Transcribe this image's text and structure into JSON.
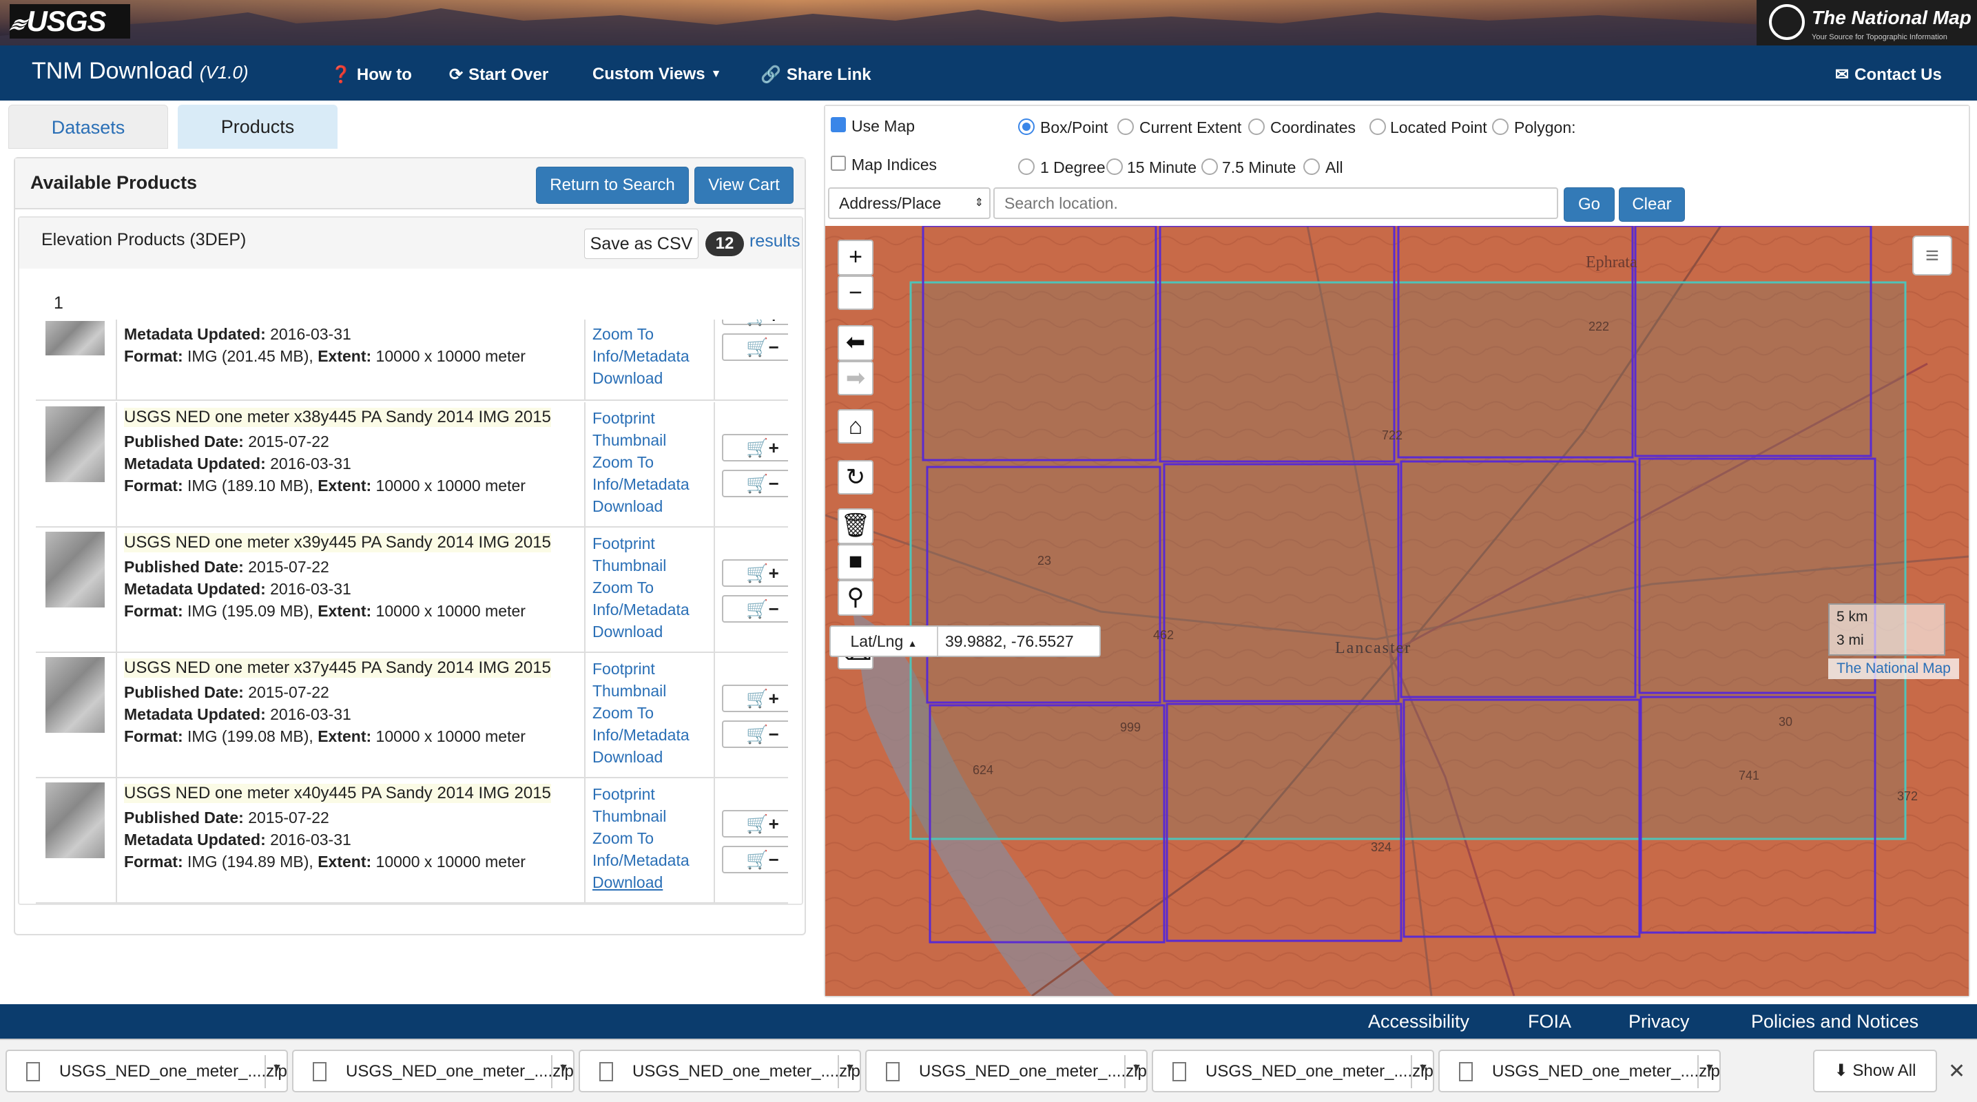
{
  "banner": {
    "usgs_logo": "USGS",
    "tnm_title": "The National Map",
    "tnm_subtitle": "Your Source for Topographic Information"
  },
  "navbar": {
    "brand": "TNM Download",
    "version": "(V1.0)",
    "how_to": "How to",
    "start_over": "Start Over",
    "custom_views": "Custom Views",
    "share_link": "Share Link",
    "contact_us": "Contact Us"
  },
  "tabs": {
    "datasets": "Datasets",
    "products": "Products"
  },
  "products": {
    "heading": "Available Products",
    "return_to_search": "Return to Search",
    "view_cart": "View Cart",
    "group_title": "Elevation Products (3DEP)",
    "save_csv": "Save as CSV",
    "result_count": "12",
    "results_label": "results",
    "page": "1",
    "labels": {
      "published": "Published Date:",
      "metadata": "Metadata Updated:",
      "format": "Format:",
      "extent": "Extent:"
    },
    "links": [
      "Footprint",
      "Thumbnail",
      "Zoom To",
      "Info/Metadata",
      "Download"
    ],
    "partial_row": {
      "metadata": "2016-03-31",
      "format": "IMG (201.45 MB),",
      "extent": "10000 x 10000 meter"
    },
    "rows": [
      {
        "name": "USGS NED one meter x38y445 PA Sandy 2014 IMG 2015",
        "published": "2015-07-22",
        "metadata": "2016-03-31",
        "format": "IMG (189.10 MB),",
        "extent": "10000 x 10000 meter"
      },
      {
        "name": "USGS NED one meter x39y445 PA Sandy 2014 IMG 2015",
        "published": "2015-07-22",
        "metadata": "2016-03-31",
        "format": "IMG (195.09 MB),",
        "extent": "10000 x 10000 meter"
      },
      {
        "name": "USGS NED one meter x37y445 PA Sandy 2014 IMG 2015",
        "published": "2015-07-22",
        "metadata": "2016-03-31",
        "format": "IMG (199.08 MB),",
        "extent": "10000 x 10000 meter"
      },
      {
        "name": "USGS NED one meter x40y445 PA Sandy 2014 IMG 2015",
        "published": "2015-07-22",
        "metadata": "2016-03-31",
        "format": "IMG (194.89 MB),",
        "extent": "10000 x 10000 meter"
      }
    ]
  },
  "map_toolbar": {
    "use_map": "Use Map",
    "map_indices": "Map Indices",
    "box_point": "Box/Point",
    "current_extent": "Current Extent",
    "coordinates": "Coordinates",
    "located_point": "Located Point",
    "polygon": "Polygon:",
    "one_degree": "1 Degree",
    "fifteen_minute": "15 Minute",
    "seven_half_minute": "7.5 Minute",
    "all": "All",
    "address_select": "Address/Place",
    "search_placeholder": "Search location.",
    "go": "Go",
    "clear": "Clear"
  },
  "map": {
    "place_ephrata": "Ephrata",
    "place_lancaster": "Lancaster",
    "route_labels": [
      "222",
      "722",
      "23",
      "462",
      "999",
      "30",
      "741",
      "324",
      "624",
      "372"
    ],
    "scale_km": "5 km",
    "scale_mi": "3 mi",
    "attribution": "The National Map",
    "latlng_label": "Lat/Lng",
    "latlng_value": "39.9882, -76.5527",
    "colors": {
      "terrain": "#c86a48",
      "tile_outline": "#5a2bd0",
      "aoi_outline": "#4fc3b8"
    }
  },
  "footer": {
    "accessibility": "Accessibility",
    "foia": "FOIA",
    "privacy": "Privacy",
    "policies": "Policies and Notices"
  },
  "downloads": {
    "items": [
      "USGS_NED_one_meter_....zip",
      "USGS_NED_one_meter_....zip",
      "USGS_NED_one_meter_....zip",
      "USGS_NED_one_meter_....zip",
      "USGS_NED_one_meter_....zip",
      "USGS_NED_one_meter_....zip"
    ],
    "show_all": "Show All"
  }
}
